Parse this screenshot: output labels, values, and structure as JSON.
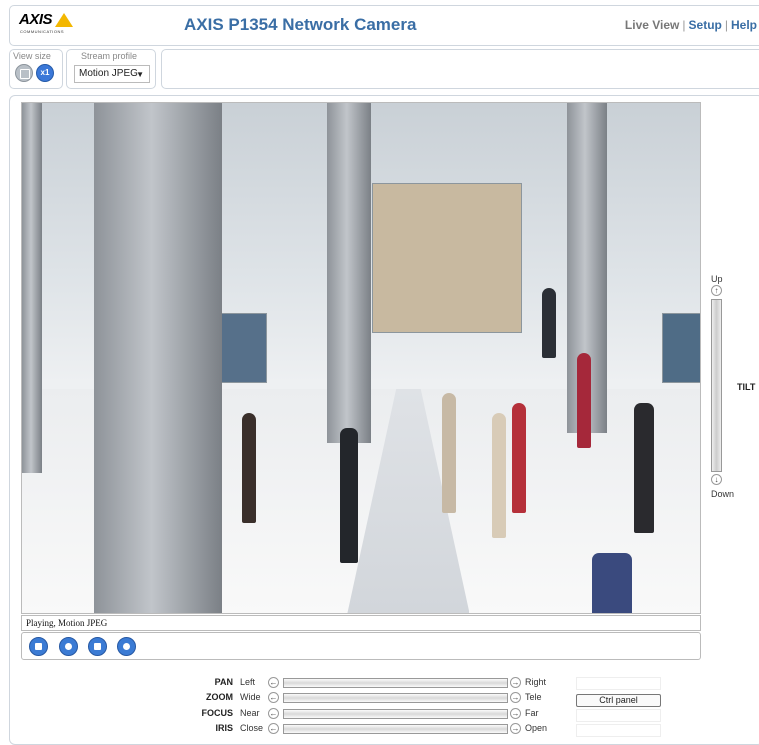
{
  "header": {
    "logo_text": "AXIS",
    "logo_sub": "COMMUNICATIONS",
    "title": "AXIS P1354 Network Camera",
    "nav": {
      "live_view": "Live View",
      "setup": "Setup",
      "help": "Help",
      "separator": "|"
    }
  },
  "toolbar": {
    "view_size_label": "View size",
    "view_size_x1": "x1",
    "stream_profile_label": "Stream profile",
    "stream_profile_value": "Motion JPEG"
  },
  "video": {
    "status": "Playing, Motion JPEG"
  },
  "tilt": {
    "up": "Up",
    "down": "Down",
    "title": "TILT"
  },
  "ptz": {
    "rows": [
      {
        "name": "PAN",
        "min": "Left",
        "max": "Right"
      },
      {
        "name": "ZOOM",
        "min": "Wide",
        "max": "Tele"
      },
      {
        "name": "FOCUS",
        "min": "Near",
        "max": "Far"
      },
      {
        "name": "IRIS",
        "min": "Close",
        "max": "Open"
      }
    ],
    "ctrl_panel": "Ctrl panel"
  },
  "colors": {
    "accent": "#3a6ea5",
    "button_blue": "#3b7bd4",
    "logo_yellow": "#f3b700"
  }
}
